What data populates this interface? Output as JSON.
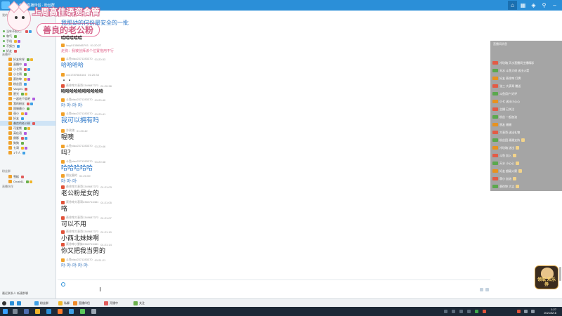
{
  "window": {
    "title": "斗鱼TV直播伴侣 · 粉丝群"
  },
  "banner": {
    "line1": "上周高佳语资食管",
    "line2": "善良的老公粉"
  },
  "chat": {
    "messages": [
      {
        "user": "",
        "time": "",
        "body": "我那幼的何份最安全的一批",
        "style": "blue"
      },
      {
        "user": "",
        "time": "",
        "body": "哈哈哈哈哈",
        "style": "bold"
      },
      {
        "user": "lucy01356985793",
        "time": "01:20:27",
        "body": "走狗：我被创拜该个位置拖用不行",
        "style": "pink"
      },
      {
        "user": "斗鱼xiao2371283370",
        "time": "01:20:33",
        "body": "哈哈哈哈",
        "style": "blue"
      },
      {
        "user": "xxx1787684444",
        "time": "01:20:34",
        "body": "・・",
        "style": ""
      },
      {
        "user": "蔡徐坤大表哥1349687373",
        "time": "01:20:38",
        "body": "哈哈哈哈哈哈哈哈哈哈",
        "style": "bold"
      },
      {
        "user": "斗鱼xiao2371283370",
        "time": "01:20:40",
        "body": "卟卟卟卟",
        "style": "wave"
      },
      {
        "user": "斗鱼xiao2371283370",
        "time": "01:20:41",
        "body": "我可以拥有吗",
        "style": "blue big"
      },
      {
        "user": "冷玫瑰",
        "time": "01:20:42",
        "body": "喔噢",
        "style": "big"
      },
      {
        "user": "斗鱼xiao2371283370",
        "time": "01:20:46",
        "body": "吗？",
        "style": "big"
      },
      {
        "user": "斗鱼xiao2371283370",
        "time": "01:20:48",
        "body": "哈哈哈哈哈",
        "style": "blue big"
      },
      {
        "user": "朋友圈的",
        "time": "01:20:59",
        "body": "卟卟卟",
        "style": "wave"
      },
      {
        "user": "蔡徐坤大表哥1349687373",
        "time": "01:21:03",
        "body": "老公粉是女的",
        "style": "big"
      },
      {
        "user": "蔡徐坤大表哥2360713481",
        "time": "01:21:05",
        "body": "咯",
        "style": "big"
      },
      {
        "user": "蔡徐坤大表哥1349687373",
        "time": "01:21:07",
        "body": "可以不用",
        "style": "big"
      },
      {
        "user": "蔡徐坤大表哥1349687373",
        "time": "01:21:10",
        "body": "小西北妹妹啊",
        "style": "big"
      },
      {
        "user": "蔡徐坤小野妹2360713481",
        "time": "01:21:14",
        "body": "你又把我当男的",
        "style": "big"
      },
      {
        "user": "斗鱼xiao2371283370",
        "time": "01:21:21",
        "body": "卟卟卟卟卟",
        "style": "wave"
      }
    ]
  },
  "sidebar": {
    "groups": [
      {
        "label": "我的好友"
      },
      {
        "label": "直播中"
      },
      {
        "label": "粉丝群"
      },
      {
        "label": "直播伙伴"
      }
    ],
    "items": [
      {
        "label": "当年不努力，"
      },
      {
        "label": "和气"
      },
      {
        "label": "手机"
      },
      {
        "label": "不努力"
      },
      {
        "label": "好友"
      },
      {
        "label": "好友伙伴"
      },
      {
        "label": "直播中"
      },
      {
        "label": "小七哥"
      },
      {
        "label": "小七哥"
      },
      {
        "label": "蔡徐坤"
      },
      {
        "label": "粉丝团"
      },
      {
        "label": "Vanpes"
      },
      {
        "label": "星光"
      },
      {
        "label": "一起吃个饭吧"
      },
      {
        "label": "我的粉丝"
      },
      {
        "label": "国服最小"
      },
      {
        "label": "萌小"
      },
      {
        "label": "好友"
      },
      {
        "label": "善良的老公粉"
      },
      {
        "label": "可爱熊"
      },
      {
        "label": "高佳语"
      },
      {
        "label": "倒影"
      },
      {
        "label": "狗狗"
      },
      {
        "label": "七哥"
      },
      {
        "label": "1个人"
      },
      {
        "label": "雪糕"
      },
      {
        "label": "Crush11"
      }
    ],
    "footer": "最近联系人 新建群聊"
  },
  "overlay": {
    "header": "直播间消息",
    "rows": [
      "冷玫瑰 天水直播间主播精彩",
      "天水 斗鱼大佬 送出火箭",
      "好友 蔡徐坤 灯牌",
      "张三 大表哥 赠送",
      "斗鱼用户 好评",
      "小七 送出小心心",
      "主播 已关注",
      "粉丝 一起加油",
      "朋友 谢谢",
      "大表哥 送出礼物",
      "粉丝团 谢谢支持",
      "冷玫瑰 送出",
      "斗鱼 加入",
      "天水 小心心",
      "好友 超级火箭",
      "萌小 加油",
      "蔡徐坤 大吉"
    ]
  },
  "gift": {
    "label": "领取 欢乐券"
  },
  "taskbar": {
    "items": [
      "粉丝群",
      "私聊",
      "直播伴侣",
      "开播中",
      "关注"
    ],
    "clock_time": "1:27",
    "clock_date": "2021/8/16"
  }
}
